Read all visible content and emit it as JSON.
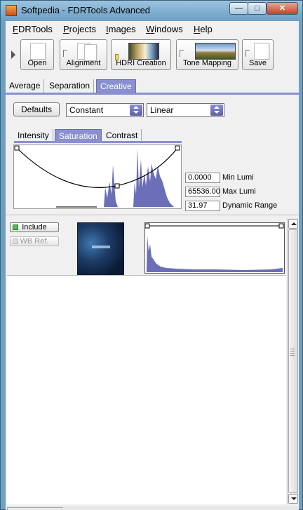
{
  "window": {
    "title": "Softpedia - FDRTools Advanced",
    "minimize": "—",
    "maximize": "□",
    "close": "✕"
  },
  "menu": [
    "FDRTools",
    "Projects",
    "Images",
    "Windows",
    "Help"
  ],
  "toolbar": {
    "open": "Open",
    "alignment": "Alignment",
    "hdri_creation": "HDRI Creation",
    "tone_mapping": "Tone Mapping",
    "save": "Save"
  },
  "main_tabs": [
    "Average",
    "Separation",
    "Creative"
  ],
  "controls": {
    "defaults": "Defaults",
    "mode_select": "Constant",
    "curve_select": "Linear"
  },
  "sub_tabs": [
    "Intensity",
    "Saturation",
    "Contrast"
  ],
  "stats": {
    "min_lumi_value": "0.0000",
    "min_lumi_label": "Min Lumi",
    "max_lumi_value": "65536.00",
    "max_lumi_label": "Max Lumi",
    "dynamic_range_value": "31.97",
    "dynamic_range_label": "Dynamic Range"
  },
  "image_row": {
    "include": "Include",
    "wb_ref": "WB Ref."
  },
  "colors": {
    "accent": "#8a8fd0",
    "histogram": "#6b6fb8"
  }
}
